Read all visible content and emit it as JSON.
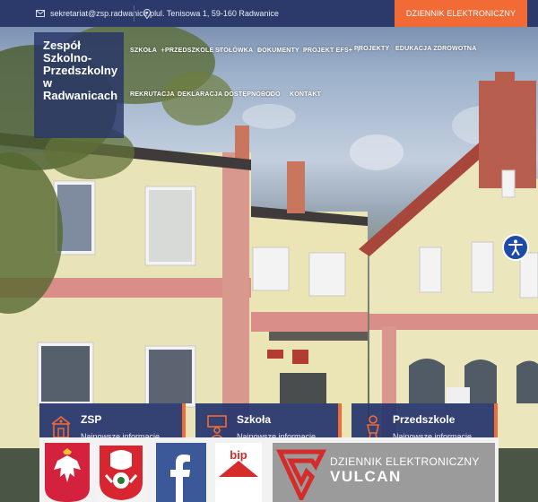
{
  "topbar": {
    "email": "sekretariat@zsp.radwanice.pl",
    "address": "ul. Tenisowa 1, 59-160 Radwanice",
    "diary_button": "DZIENNIK ELEKTRONICZNY"
  },
  "logo": {
    "line1": "Zespół",
    "line2": "Szkolno-",
    "line3": "Przedszkolny",
    "line4": "w",
    "line5": "Radwanicach"
  },
  "nav": {
    "row1": [
      "SZKOŁA",
      "PRZEDSZKOLE",
      "STOŁÓWKA",
      "DOKUMENTY",
      "PROJEKT EFS+",
      "PROJEKTY",
      "EDUKACJA ZDROWOTNA"
    ],
    "row2": [
      "REKRUTACJA",
      "DEKLARACJA DOSTĘPNOŚCI",
      "RODO",
      "KONTAKT"
    ]
  },
  "cards": [
    {
      "title": "ZSP",
      "subtitle": "Najnowsze informacje",
      "icon": "school-building-icon"
    },
    {
      "title": "Szkoła",
      "subtitle": "Najnowsze informacje",
      "icon": "teacher-board-icon"
    },
    {
      "title": "Przedszkole",
      "subtitle": "Najnowsze informacje",
      "icon": "child-icon"
    }
  ],
  "banners": {
    "bip": "bip",
    "vulcan_line1": "DZIENNIK ELEKTRONICZNY",
    "vulcan_line2": "VULCAN"
  },
  "colors": {
    "navy": "#2b3a6b",
    "accent": "#f26b36",
    "card": "#28366e"
  }
}
